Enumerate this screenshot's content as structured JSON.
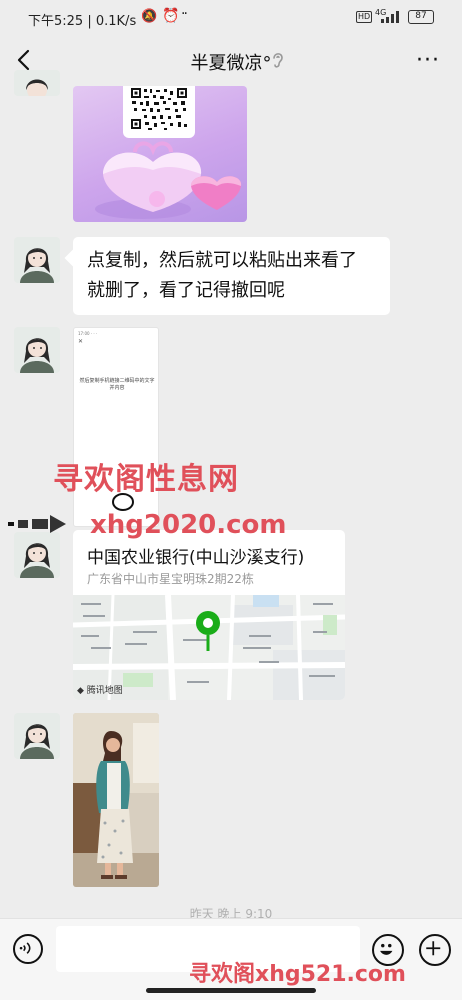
{
  "status_bar": {
    "time": "下午5:25",
    "speed": "0.1K/s",
    "hd": "HD",
    "network": "4G",
    "battery": "87"
  },
  "header": {
    "title": "半夏微凉°",
    "icons": [
      "back-arrow-icon",
      "ear-icon",
      "more-icon"
    ]
  },
  "messages": [
    {
      "type": "image",
      "content": "qr-code-gift-image"
    },
    {
      "type": "text",
      "lines": [
        "点复制，然后就可以粘贴出来看了",
        "就删了，看了记得撤回呢"
      ]
    },
    {
      "type": "image",
      "content": "phone-screenshot",
      "screenshot_text": "然后复制手机链接二维码中的文字并内容"
    },
    {
      "type": "location",
      "name": "中国农业银行(中山沙溪支行)",
      "address": "广东省中山市星宝明珠2期22栋",
      "map_brand": "腾讯地图"
    },
    {
      "type": "image",
      "content": "woman-photo"
    }
  ],
  "timestamp_partial": "昨天 晚上 9:10",
  "watermarks": {
    "top": "寻欢阁性息网",
    "url": "xhg2020.com",
    "bottom": "寻欢阁xhg521.com"
  },
  "input_bar": {
    "icons": [
      "voice-icon",
      "emoji-icon",
      "plus-icon"
    ]
  },
  "colors": {
    "background": "#ededed",
    "bubble": "#ffffff",
    "watermark": "#e0505a",
    "map_pin": "#1aad19"
  }
}
